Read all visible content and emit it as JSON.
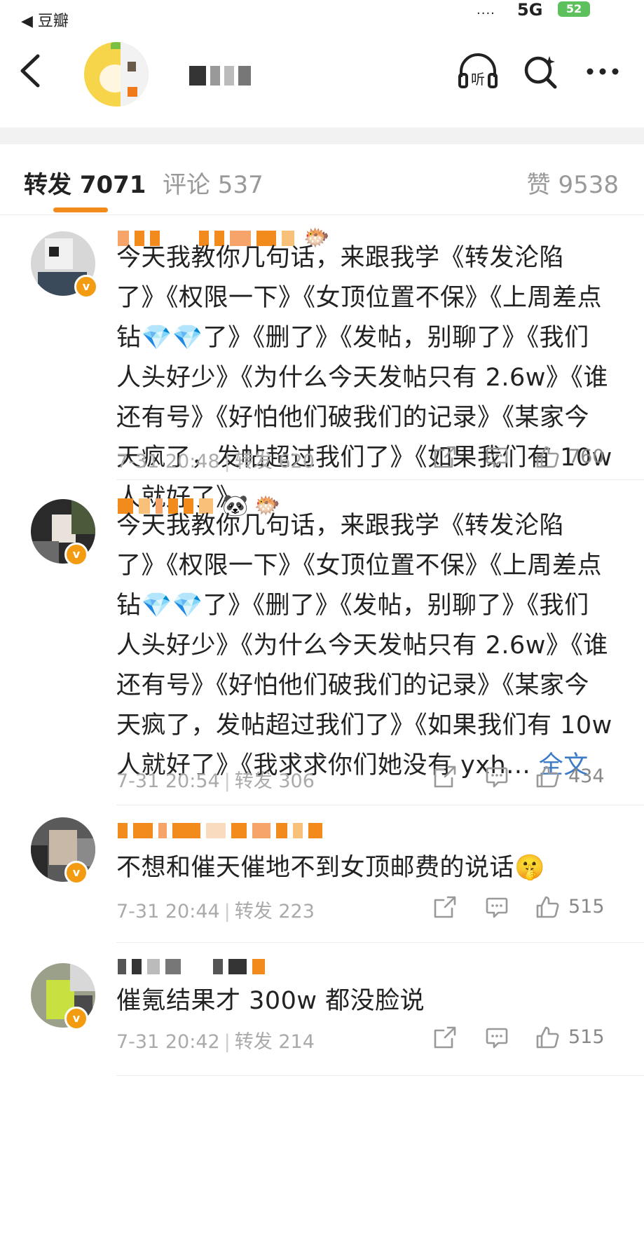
{
  "status_bar": {
    "back_app": "◀ 豆瓣",
    "signal": "....",
    "network": "5G",
    "battery": "52"
  },
  "header": {
    "back_icon": "chevron-left-icon",
    "listen_label": "听",
    "search_icon": "search-sparkle-icon",
    "more_icon": "more-dots-icon"
  },
  "tabs": {
    "repost": "转发 7071",
    "comment": "评论 537",
    "like": "赞 9538"
  },
  "posts": [
    {
      "content": "今天我教你几句话，来跟我学《转发沦陷了》《权限一下》《女顶位置不保》《上周差点钻💎💎了》《删了》《发帖，别聊了》《我们人头好少》《为什么今天发帖只有 2.6w》《谁还有号》《好怕他们破我们的记录》《某家今天疯了，发帖超过我们了》《如果我们有 10w 人就好了》",
      "time": "7-31 20:48",
      "repost": "转发 620",
      "likes": "760"
    },
    {
      "content": "今天我教你几句话，来跟我学《转发沦陷了》《权限一下》《女顶位置不保》《上周差点钻💎💎了》《删了》《发帖，别聊了》《我们人头好少》《为什么今天发帖只有 2.6w》《谁还有号》《好怕他们破我们的记录》《某家今天疯了，发帖超过我们了》《如果我们有 10w 人就好了》《我求求你们她没有 yxh... ",
      "full_text": "全文",
      "time": "7-31 20:54",
      "repost": "转发 306",
      "likes": "434"
    },
    {
      "content": "不想和催天催地不到女顶邮费的说话🤫",
      "time": "7-31 20:44",
      "repost": "转发 223",
      "likes": "515"
    },
    {
      "content": "催氪结果才 300w 都没脸说",
      "time": "7-31 20:42",
      "repost": "转发 214",
      "likes": "515"
    }
  ],
  "colors": {
    "accent": "#f28b1c",
    "link": "#3c7bc8",
    "badge": "#f39c12"
  }
}
